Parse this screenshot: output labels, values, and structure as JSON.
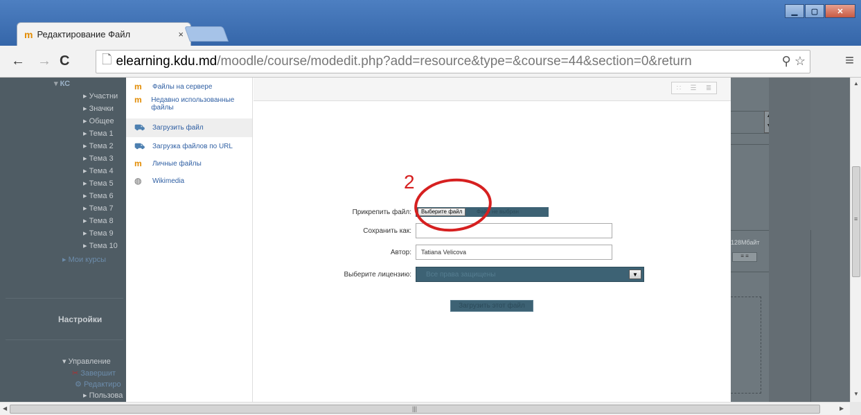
{
  "browser": {
    "tab_title": "Редактирование Файл",
    "tab_close": "×",
    "url_host": "elearning.kdu.md",
    "url_path": "/moodle/course/modedit.php?add=resource&type=&course=44&section=0&return",
    "favicon": "moodle-m-icon",
    "window_buttons": [
      "minimize",
      "maximize",
      "close"
    ]
  },
  "nav_tree": {
    "course": "КС",
    "items": [
      "Участни",
      "Значки",
      "Общее",
      "Тема 1",
      "Тема 2",
      "Тема 3",
      "Тема 4",
      "Тема 5",
      "Тема 6",
      "Тема 7",
      "Тема 8",
      "Тема 9",
      "Тема 10"
    ],
    "my_courses": "Мои курсы"
  },
  "settings_block": {
    "title": "Настройки",
    "manage": "Управление",
    "items": [
      "Завершит",
      "Редактиро",
      "Пользова"
    ]
  },
  "repositories": [
    {
      "label": "Файлы на сервере",
      "icon": "moodle-m-icon",
      "active": false
    },
    {
      "label": "Недавно использованные файлы",
      "icon": "moodle-m-icon",
      "active": false
    },
    {
      "label": "Загрузить файл",
      "icon": "upload-icon",
      "active": true
    },
    {
      "label": "Загрузка файлов по URL",
      "icon": "url-download-icon",
      "active": false
    },
    {
      "label": "Личные файлы",
      "icon": "moodle-m-icon",
      "active": false
    },
    {
      "label": "Wikimedia",
      "icon": "wikimedia-icon",
      "active": false
    }
  ],
  "upload_form": {
    "attach_label": "Прикрепить файл:",
    "choose_button": "Выберите файл",
    "no_file_text": "Файл не выбран",
    "save_as_label": "Сохранить как:",
    "save_as_value": "",
    "author_label": "Автор:",
    "author_value": "Tatiana Velicova",
    "license_label": "Выберите лицензию:",
    "license_value": "Все права защищены",
    "upload_button": "Загрузить этот файл"
  },
  "right_panel": {
    "max_size": "128Мбайт"
  },
  "annotation": {
    "number": "2",
    "color": "#d62020"
  },
  "colors": {
    "overlay_dark": "#3d6274",
    "link_blue": "#2f5fa3",
    "titlebar_blue": "#3566a9"
  }
}
